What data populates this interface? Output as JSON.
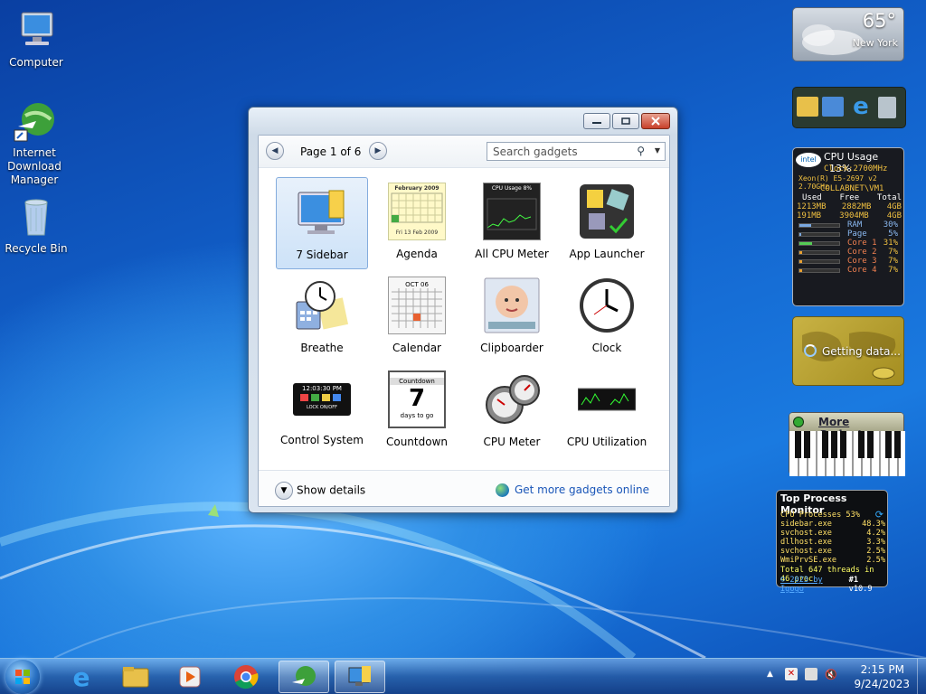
{
  "desktop": {
    "icons": [
      {
        "label": "Computer"
      },
      {
        "label": "Internet Download Manager"
      },
      {
        "label": "Recycle Bin"
      }
    ]
  },
  "gadget_window": {
    "page_info": "Page 1 of 6",
    "search_placeholder": "Search gadgets",
    "gadgets": [
      {
        "label": "7 Sidebar",
        "selected": true
      },
      {
        "label": "Agenda"
      },
      {
        "label": "All CPU Meter"
      },
      {
        "label": "App Launcher"
      },
      {
        "label": "Breathe"
      },
      {
        "label": "Calendar"
      },
      {
        "label": "Clipboarder"
      },
      {
        "label": "Clock"
      },
      {
        "label": "Control System"
      },
      {
        "label": "Countdown"
      },
      {
        "label": "CPU Meter"
      },
      {
        "label": "CPU Utilization"
      }
    ],
    "show_details": "Show details",
    "get_more": "Get more gadgets online",
    "thumb_text": {
      "agenda_month": "February 2009",
      "agenda_day": "Fri 13 Feb 2009",
      "cpu_title": "CPU Usage",
      "cpu_pct": "8%",
      "calendar_month": "OCT 06",
      "control_time": "12:03:30 PM",
      "control_lock": "LOCK ON/OFF",
      "countdown_head": "Countdown",
      "countdown_num": "7",
      "countdown_foot": "days to go"
    }
  },
  "weather": {
    "temp": "65°",
    "city": "New York"
  },
  "cpu_gadget": {
    "title": "CPU Usage",
    "usage": "13%",
    "clock": "Clock:2700MHz",
    "cpu_model": "Xeon(R) E5-2697 v2 2.70GHz",
    "host": "COLLABNET\\VM1",
    "headers": [
      "Used",
      "Free",
      "Total"
    ],
    "rows": [
      [
        "1213MB",
        "2882MB",
        "4GB"
      ],
      [
        "191MB",
        "3904MB",
        "4GB"
      ]
    ],
    "bars": [
      {
        "label": "RAM",
        "value": "30%",
        "fill": 0.3
      },
      {
        "label": "Page",
        "value": "5%",
        "fill": 0.05
      },
      {
        "label": "Core 1",
        "value": "31%",
        "fill": 0.31
      },
      {
        "label": "Core 2",
        "value": "7%",
        "fill": 0.07
      },
      {
        "label": "Core 3",
        "value": "7%",
        "fill": 0.07
      },
      {
        "label": "Core 4",
        "value": "7%",
        "fill": 0.07
      }
    ]
  },
  "map_gadget": {
    "status": "Getting data..."
  },
  "more_gadgets": {
    "label": "More Gadgets"
  },
  "top_process": {
    "title": "Top Process Monitor",
    "summary": "CPU Processes 53%",
    "rows": [
      {
        "name": "sidebar.exe",
        "pct": "48.3%"
      },
      {
        "name": "svchost.exe",
        "pct": "4.2%"
      },
      {
        "name": "dllhost.exe",
        "pct": "3.3%"
      },
      {
        "name": "svchost.exe",
        "pct": "2.5%"
      },
      {
        "name": "WmiPrvSE.exe",
        "pct": "2.5%"
      }
    ],
    "total": "Total 647 threads in 46 proc",
    "footer_link": "© 2023 by Igogo",
    "footer_rank": "#1",
    "footer_version": "v10.9"
  },
  "taskbar": {
    "apps": [
      "internet-explorer",
      "file-explorer",
      "media-player",
      "chrome",
      "internet-download-manager",
      "gadgets"
    ],
    "clock_time": "2:15 PM",
    "clock_date": "9/24/2023"
  },
  "colors": {
    "selection": "#cde2f8",
    "link": "#1a56b8",
    "cpu_text": "#f0c040"
  }
}
